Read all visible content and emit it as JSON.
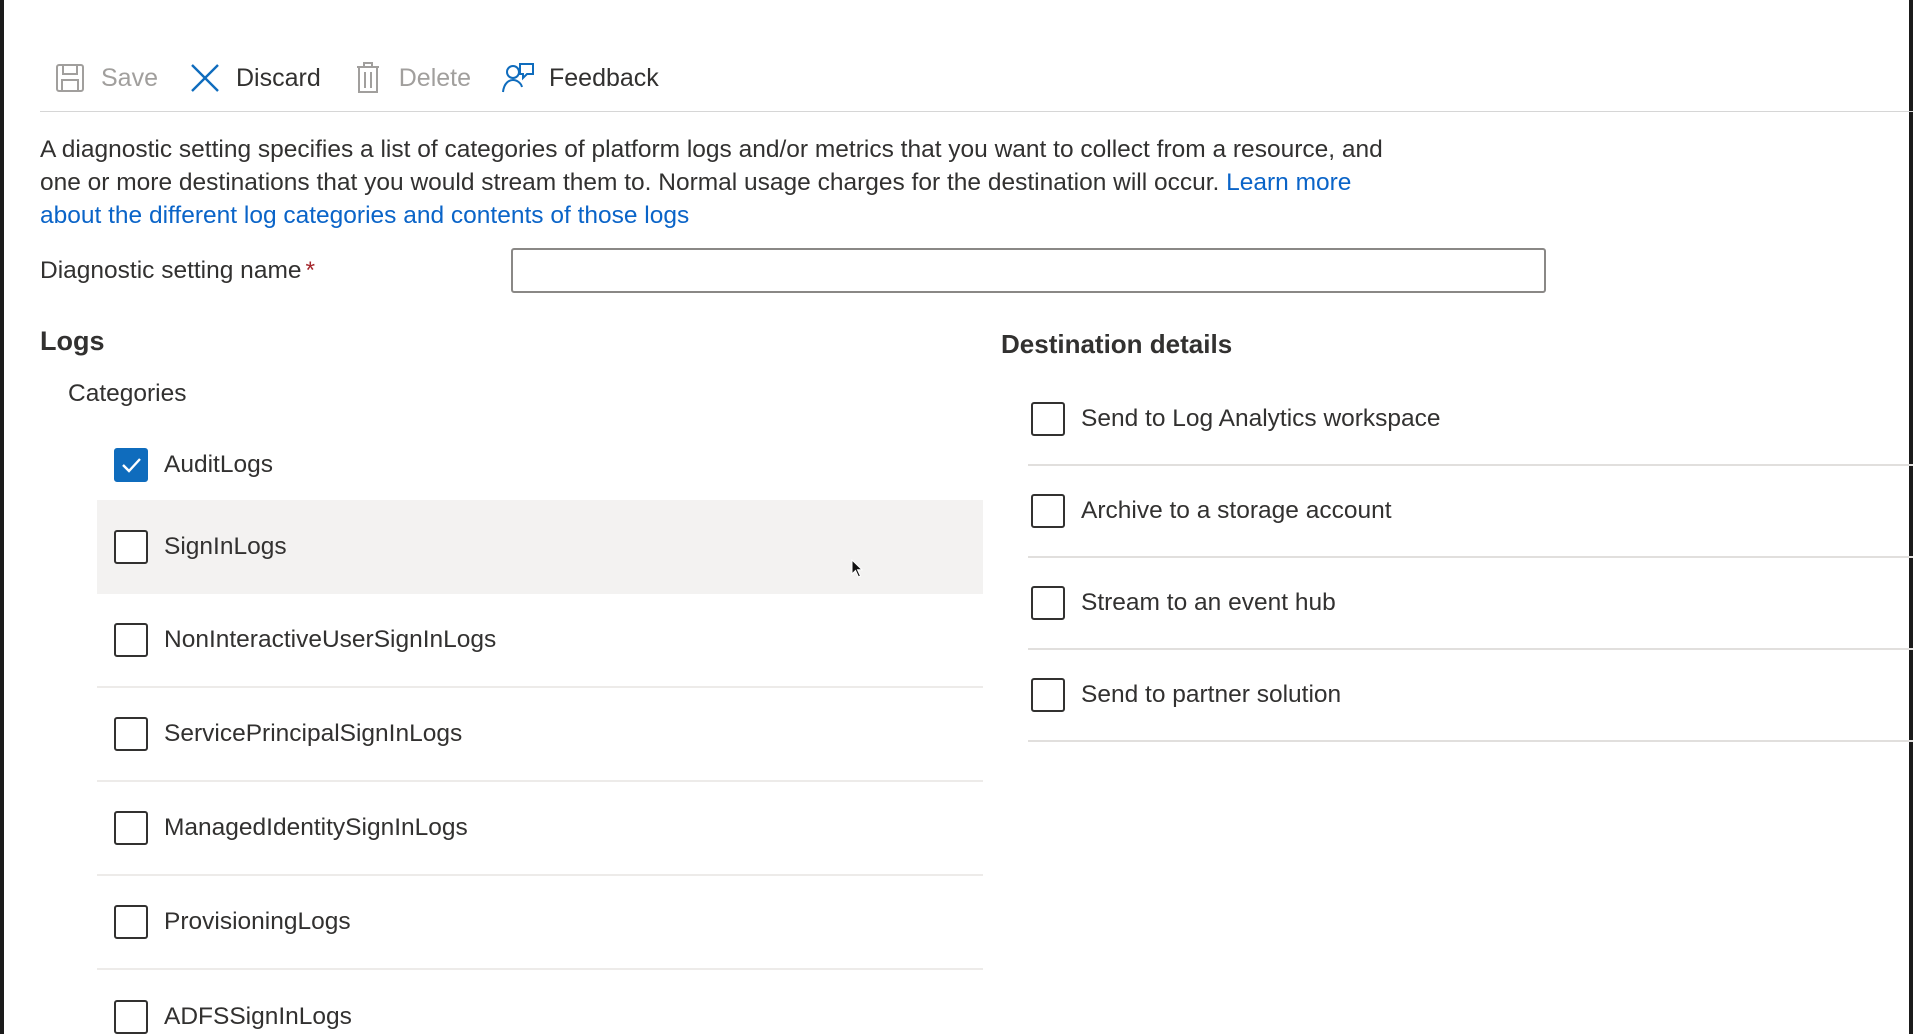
{
  "toolbar": {
    "save_label": "Save",
    "discard_label": "Discard",
    "delete_label": "Delete",
    "feedback_label": "Feedback"
  },
  "description": {
    "text": "A diagnostic setting specifies a list of categories of platform logs and/or metrics that you want to collect from a resource, and one or more destinations that you would stream them to. Normal usage charges for the destination will occur. ",
    "link_text": "Learn more about the different log categories and contents of those logs"
  },
  "name_field": {
    "label": "Diagnostic setting name",
    "required_marker": "*",
    "value": ""
  },
  "logs": {
    "heading": "Logs",
    "categories_label": "Categories",
    "items": [
      {
        "label": "AuditLogs",
        "checked": true
      },
      {
        "label": "SignInLogs",
        "checked": false
      },
      {
        "label": "NonInteractiveUserSignInLogs",
        "checked": false
      },
      {
        "label": "ServicePrincipalSignInLogs",
        "checked": false
      },
      {
        "label": "ManagedIdentitySignInLogs",
        "checked": false
      },
      {
        "label": "ProvisioningLogs",
        "checked": false
      },
      {
        "label": "ADFSSignInLogs",
        "checked": false
      }
    ]
  },
  "destination": {
    "heading": "Destination details",
    "items": [
      {
        "label": "Send to Log Analytics workspace",
        "checked": false
      },
      {
        "label": "Archive to a storage account",
        "checked": false
      },
      {
        "label": "Stream to an event hub",
        "checked": false
      },
      {
        "label": "Send to partner solution",
        "checked": false
      }
    ]
  },
  "colors": {
    "accent": "#0f6cbd",
    "link": "#0a64c8",
    "required": "#a4262c",
    "hover_row": "#f3f2f1"
  }
}
